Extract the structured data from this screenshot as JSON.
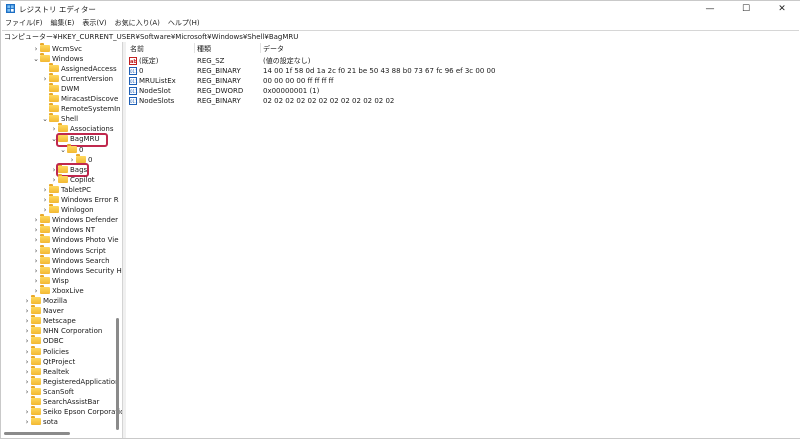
{
  "window": {
    "title": "レジストリ エディター",
    "min_glyph": "—",
    "max_glyph": "☐",
    "close_glyph": "✕"
  },
  "menu": [
    "ファイル(F)",
    "編集(E)",
    "表示(V)",
    "お気に入り(A)",
    "ヘルプ(H)"
  ],
  "address": "コンピューター¥HKEY_CURRENT_USER¥Software¥Microsoft¥Windows¥Shell¥BagMRU",
  "tree": [
    {
      "label": "WcmSvc",
      "indent": 3,
      "chevron": ">"
    },
    {
      "label": "Windows",
      "indent": 3,
      "chevron": "v"
    },
    {
      "label": "AssignedAccess",
      "indent": 4,
      "chevron": ""
    },
    {
      "label": "CurrentVersion",
      "indent": 4,
      "chevron": ">"
    },
    {
      "label": "DWM",
      "indent": 4,
      "chevron": ""
    },
    {
      "label": "MiracastDiscove",
      "indent": 4,
      "chevron": ""
    },
    {
      "label": "RemoteSystemIn",
      "indent": 4,
      "chevron": ""
    },
    {
      "label": "Shell",
      "indent": 4,
      "chevron": "v"
    },
    {
      "label": "Associations",
      "indent": 5,
      "chevron": ">"
    },
    {
      "label": "BagMRU",
      "indent": 5,
      "chevron": "v",
      "highlight": true
    },
    {
      "label": "0",
      "indent": 6,
      "chevron": "v"
    },
    {
      "label": "0",
      "indent": 7,
      "chevron": ">"
    },
    {
      "label": "Bags",
      "indent": 5,
      "chevron": ">",
      "highlight": true
    },
    {
      "label": "Copilot",
      "indent": 5,
      "chevron": ">"
    },
    {
      "label": "TabletPC",
      "indent": 4,
      "chevron": ">"
    },
    {
      "label": "Windows Error R",
      "indent": 4,
      "chevron": ">"
    },
    {
      "label": "Winlogon",
      "indent": 4,
      "chevron": ">"
    },
    {
      "label": "Windows Defender",
      "indent": 3,
      "chevron": ">"
    },
    {
      "label": "Windows NT",
      "indent": 3,
      "chevron": ">"
    },
    {
      "label": "Windows Photo Vie",
      "indent": 3,
      "chevron": ">"
    },
    {
      "label": "Windows Script",
      "indent": 3,
      "chevron": ">"
    },
    {
      "label": "Windows Search",
      "indent": 3,
      "chevron": ">"
    },
    {
      "label": "Windows Security H",
      "indent": 3,
      "chevron": ">"
    },
    {
      "label": "Wisp",
      "indent": 3,
      "chevron": ">"
    },
    {
      "label": "XboxLive",
      "indent": 3,
      "chevron": ">"
    },
    {
      "label": "Mozilla",
      "indent": 2,
      "chevron": ">"
    },
    {
      "label": "Naver",
      "indent": 2,
      "chevron": ">"
    },
    {
      "label": "Netscape",
      "indent": 2,
      "chevron": ">"
    },
    {
      "label": "NHN Corporation",
      "indent": 2,
      "chevron": ">"
    },
    {
      "label": "ODBC",
      "indent": 2,
      "chevron": ">"
    },
    {
      "label": "Policies",
      "indent": 2,
      "chevron": ">"
    },
    {
      "label": "QtProject",
      "indent": 2,
      "chevron": ">"
    },
    {
      "label": "Realtek",
      "indent": 2,
      "chevron": ">"
    },
    {
      "label": "RegisteredApplication",
      "indent": 2,
      "chevron": ">"
    },
    {
      "label": "ScanSoft",
      "indent": 2,
      "chevron": ">"
    },
    {
      "label": "SearchAssistBar",
      "indent": 2,
      "chevron": ""
    },
    {
      "label": "Seiko Epson Corporatio",
      "indent": 2,
      "chevron": ">"
    },
    {
      "label": "sota",
      "indent": 2,
      "chevron": ">"
    }
  ],
  "columns": {
    "name": "名前",
    "type": "種類",
    "data": "データ"
  },
  "values": [
    {
      "icon": "string-value-icon",
      "icon_glyph": "ab",
      "name": "(既定)",
      "type": "REG_SZ",
      "data": "(値の設定なし)"
    },
    {
      "icon": "binary-value-icon",
      "icon_glyph": "011",
      "name": "0",
      "type": "REG_BINARY",
      "data": "14 00 1f 58 0d 1a 2c f0 21 be 50 43 88 b0 73 67 fc 96 ef 3c 00 00"
    },
    {
      "icon": "binary-value-icon",
      "icon_glyph": "011",
      "name": "MRUListEx",
      "type": "REG_BINARY",
      "data": "00 00 00 00 ff ff ff ff"
    },
    {
      "icon": "binary-value-icon",
      "icon_glyph": "011",
      "name": "NodeSlot",
      "type": "REG_DWORD",
      "data": "0x00000001 (1)"
    },
    {
      "icon": "binary-value-icon",
      "icon_glyph": "011",
      "name": "NodeSlots",
      "type": "REG_BINARY",
      "data": "02 02 02 02 02 02 02 02 02 02 02 02"
    }
  ],
  "colors": {
    "highlight": "#c0284d",
    "folder": "#f2b833"
  }
}
